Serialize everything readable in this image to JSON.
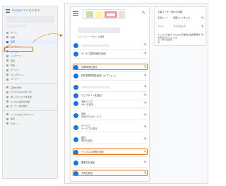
{
  "sidebar": {
    "logo_prefix": "Google",
    "logo_suffix": " マイビジネス",
    "items": [
      {
        "label": "ホーム",
        "icon": "home-icon"
      },
      {
        "label": "投稿",
        "icon": "post-icon"
      },
      {
        "label": "情報",
        "icon": "store-icon"
      },
      {
        "label": "インサイト",
        "icon": "insights-icon"
      },
      {
        "label": "クチコミ",
        "icon": "reviews-icon"
      },
      {
        "label": "メッセージ",
        "icon": "message-icon"
      },
      {
        "label": "写真",
        "icon": "photo-icon"
      },
      {
        "label": "商品",
        "icon": "product-icon"
      },
      {
        "label": "サービス",
        "icon": "service-icon"
      },
      {
        "label": "ウェブサイト",
        "icon": "website-icon"
      },
      {
        "label": "ユーザー",
        "icon": "users-icon"
      }
    ],
    "items2": [
      {
        "label": "広告を作成",
        "icon": "ads-icon"
      },
      {
        "label": "カスタムGmailを入手",
        "icon": "gmail-icon"
      },
      {
        "label": "新しいビジネスを追加",
        "icon": "add-business-icon"
      },
      {
        "label": "ビジネス情報を管理",
        "icon": "manage-icon"
      },
      {
        "label": "オーナー権の移行",
        "icon": "transfer-icon"
      }
    ],
    "items3": [
      {
        "label": "リンクされたアカウント",
        "icon": "link-icon"
      },
      {
        "label": "設定",
        "icon": "settings-icon"
      },
      {
        "label": "サポート",
        "icon": "support-icon"
      }
    ],
    "highlight_color": "#e8710a"
  },
  "main": {
    "edit_glyph": "✎",
    "category_line": "ビューティー サロン ▾ 福岡",
    "rows": [
      {
        "icon": "location-icon",
        "color": "#1a73e8",
        "text": "",
        "sub": ""
      },
      {
        "icon": "service-area-icon",
        "color": "#1a73e8",
        "text": "サービス提供地域の設定",
        "sub": ""
      },
      {
        "icon": "clock-icon",
        "color": "#1a73e8",
        "text": "営業時間を追加",
        "sub": ""
      },
      {
        "icon": "clock2-icon",
        "color": "#1a73e8",
        "text": "特別営業時間を追加（オプション）",
        "sub": ""
      },
      {
        "icon": "phone-icon",
        "color": "#1a73e8",
        "text": "",
        "sub": ""
      },
      {
        "icon": "globe-icon",
        "color": "#1a73e8",
        "text": "ウェブサイトを追加",
        "sub": ""
      },
      {
        "icon": "appointment-icon",
        "color": "#1a73e8",
        "text": "予約リンク",
        "sub": "URL を追加"
      },
      {
        "icon": "tag-icon",
        "color": "#1a73e8",
        "text": "商品",
        "sub": "商品またはサービス"
      },
      {
        "icon": "list-icon",
        "color": "#1a73e8",
        "text": "サービス",
        "sub": "サービスを追加"
      },
      {
        "icon": "attributes-icon",
        "color": "#1a73e8",
        "text": "属性",
        "sub": "属性を追加"
      },
      {
        "icon": "description-icon",
        "color": "#1a73e8",
        "text": "ビジネスの説明を追加",
        "sub": ""
      },
      {
        "icon": "opening-date-icon",
        "color": "#1a73e8",
        "text": "開業日を追加",
        "sub": ""
      },
      {
        "icon": "photo-icon",
        "color": "#1a73e8",
        "text": "写真を追加",
        "sub": ""
      }
    ]
  },
  "info": {
    "title": "上級ユーザー向けの情報",
    "rows": [
      {
        "key": "店舗コード",
        "value": "店舗コードを入力"
      },
      {
        "key": "ラベル",
        "value": "ラベルを入力"
      },
      {
        "key": "Google 広告の住所表示オプション用の電話番号",
        "value": "Google 広告用の電話番号を入力"
      }
    ]
  }
}
